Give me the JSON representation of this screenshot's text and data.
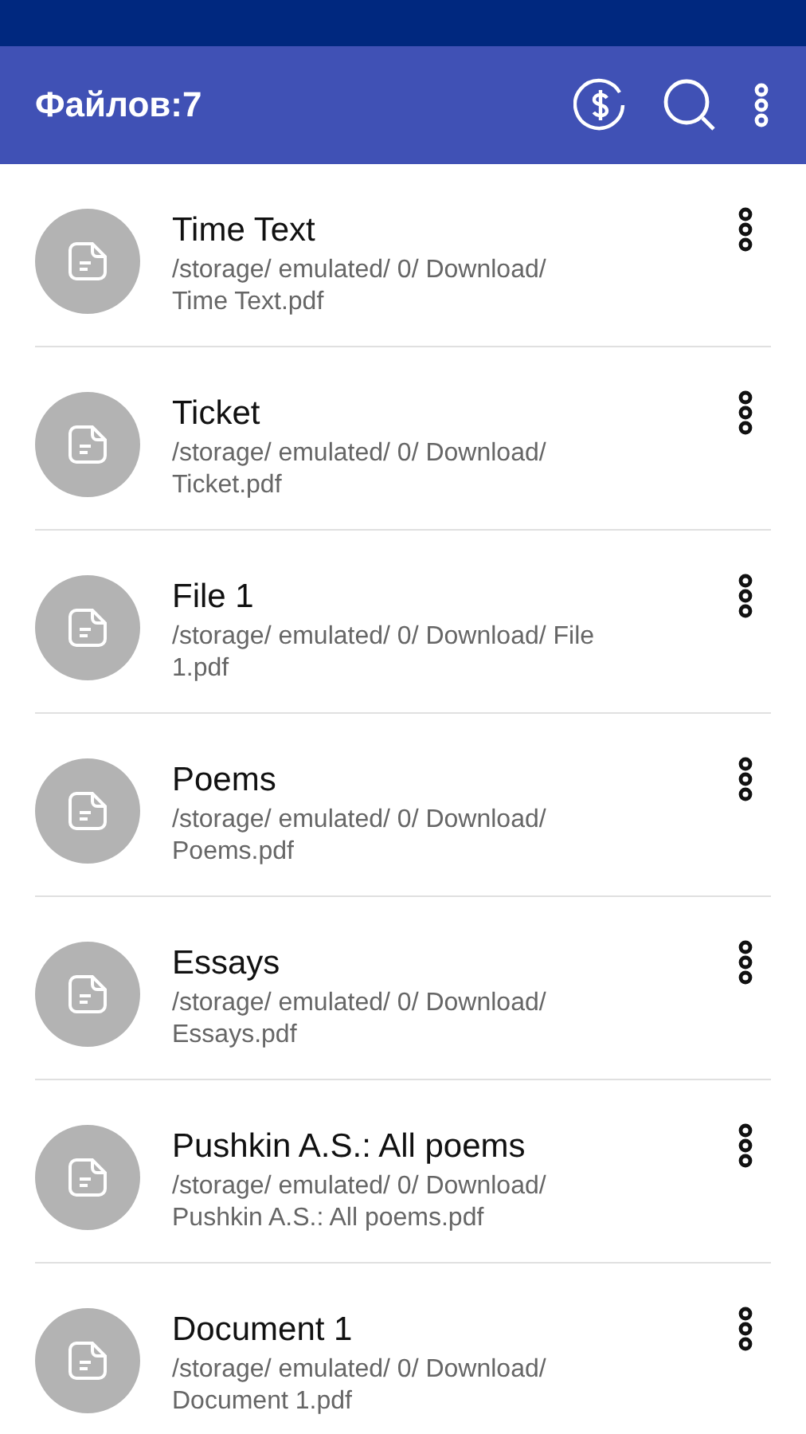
{
  "app_bar": {
    "title": "Файлов:7"
  },
  "files": [
    {
      "name": "Time Text",
      "path": "/storage/ emulated/ 0/ Download/ Time Text.pdf"
    },
    {
      "name": "Ticket",
      "path": "/storage/ emulated/ 0/ Download/ Ticket.pdf"
    },
    {
      "name": "File 1",
      "path": "/storage/ emulated/ 0/ Download/ File 1.pdf"
    },
    {
      "name": "Poems",
      "path": "/storage/ emulated/ 0/ Download/ Poems.pdf"
    },
    {
      "name": "Essays",
      "path": "/storage/ emulated/ 0/ Download/ Essays.pdf"
    },
    {
      "name": "Pushkin A.S.: All poems",
      "path": "/storage/ emulated/ 0/ Download/ Pushkin A.S.: All poems.pdf"
    },
    {
      "name": "Document 1",
      "path": "/storage/ emulated/ 0/ Download/ Document 1.pdf"
    }
  ]
}
